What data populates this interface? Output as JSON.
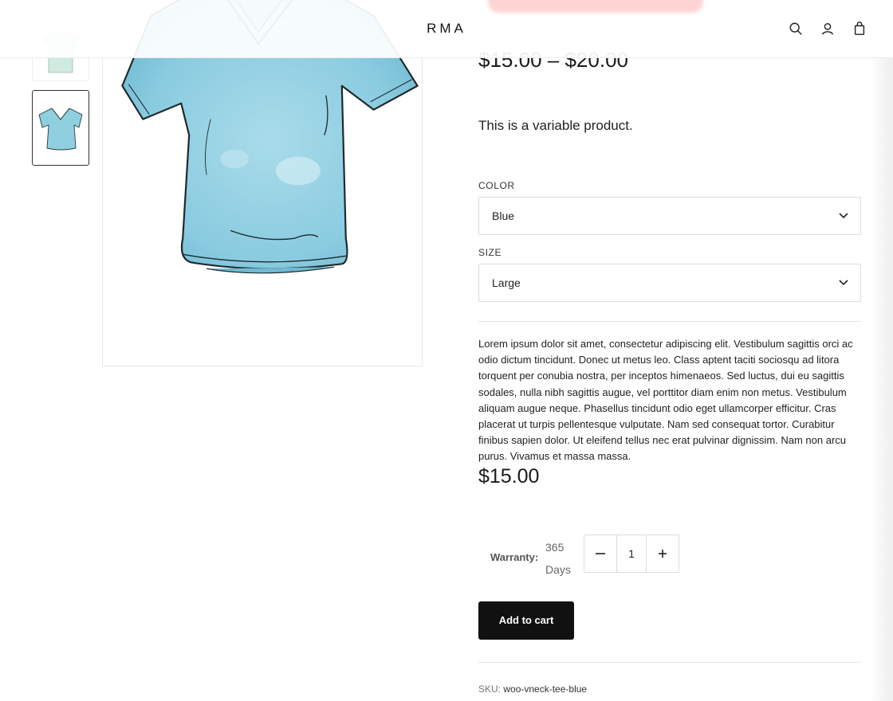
{
  "header": {
    "logo": "RMA",
    "icons": [
      "search-icon",
      "user-icon",
      "cart-icon"
    ]
  },
  "gallery": {
    "thumbnails": [
      "green-tee",
      "blue-vneck-tee"
    ],
    "active_thumbnail": 1
  },
  "product": {
    "price_range": {
      "min": "$15.00",
      "separator": "–",
      "max": "$20.00"
    },
    "short_description": "This is a variable product.",
    "attributes": [
      {
        "label": "COLOR",
        "value": "Blue"
      },
      {
        "label": "SIZE",
        "value": "Large"
      }
    ],
    "variation_description": "Lorem ipsum dolor sit amet, consectetur adipiscing elit. Vestibulum sagittis orci ac odio dictum tincidunt. Donec ut metus leo. Class aptent taciti sociosqu ad litora torquent per conubia nostra, per inceptos himenaeos. Sed luctus, dui eu sagittis sodales, nulla nibh sagittis augue, vel porttitor diam enim non metus. Vestibulum aliquam augue neque. Phasellus tincidunt odio eget ullamcorper efficitur. Cras placerat ut turpis pellentesque vulputate. Nam sed consequat tortor. Curabitur finibus sapien dolor. Ut eleifend tellus nec erat pulvinar dignissim. Nam non arcu purus. Vivamus et massa massa.",
    "variation_price": "$15.00",
    "warranty_label": "Warranty:",
    "warranty_value": "365 Days",
    "quantity": "1",
    "add_to_cart_label": "Add to cart",
    "sku_label": "SKU:",
    "sku_value": "woo-vneck-tee-blue"
  },
  "colors": {
    "accent": "#111111",
    "tee_blue": "#8fcfe0",
    "tee_green": "#a8dcc8"
  }
}
